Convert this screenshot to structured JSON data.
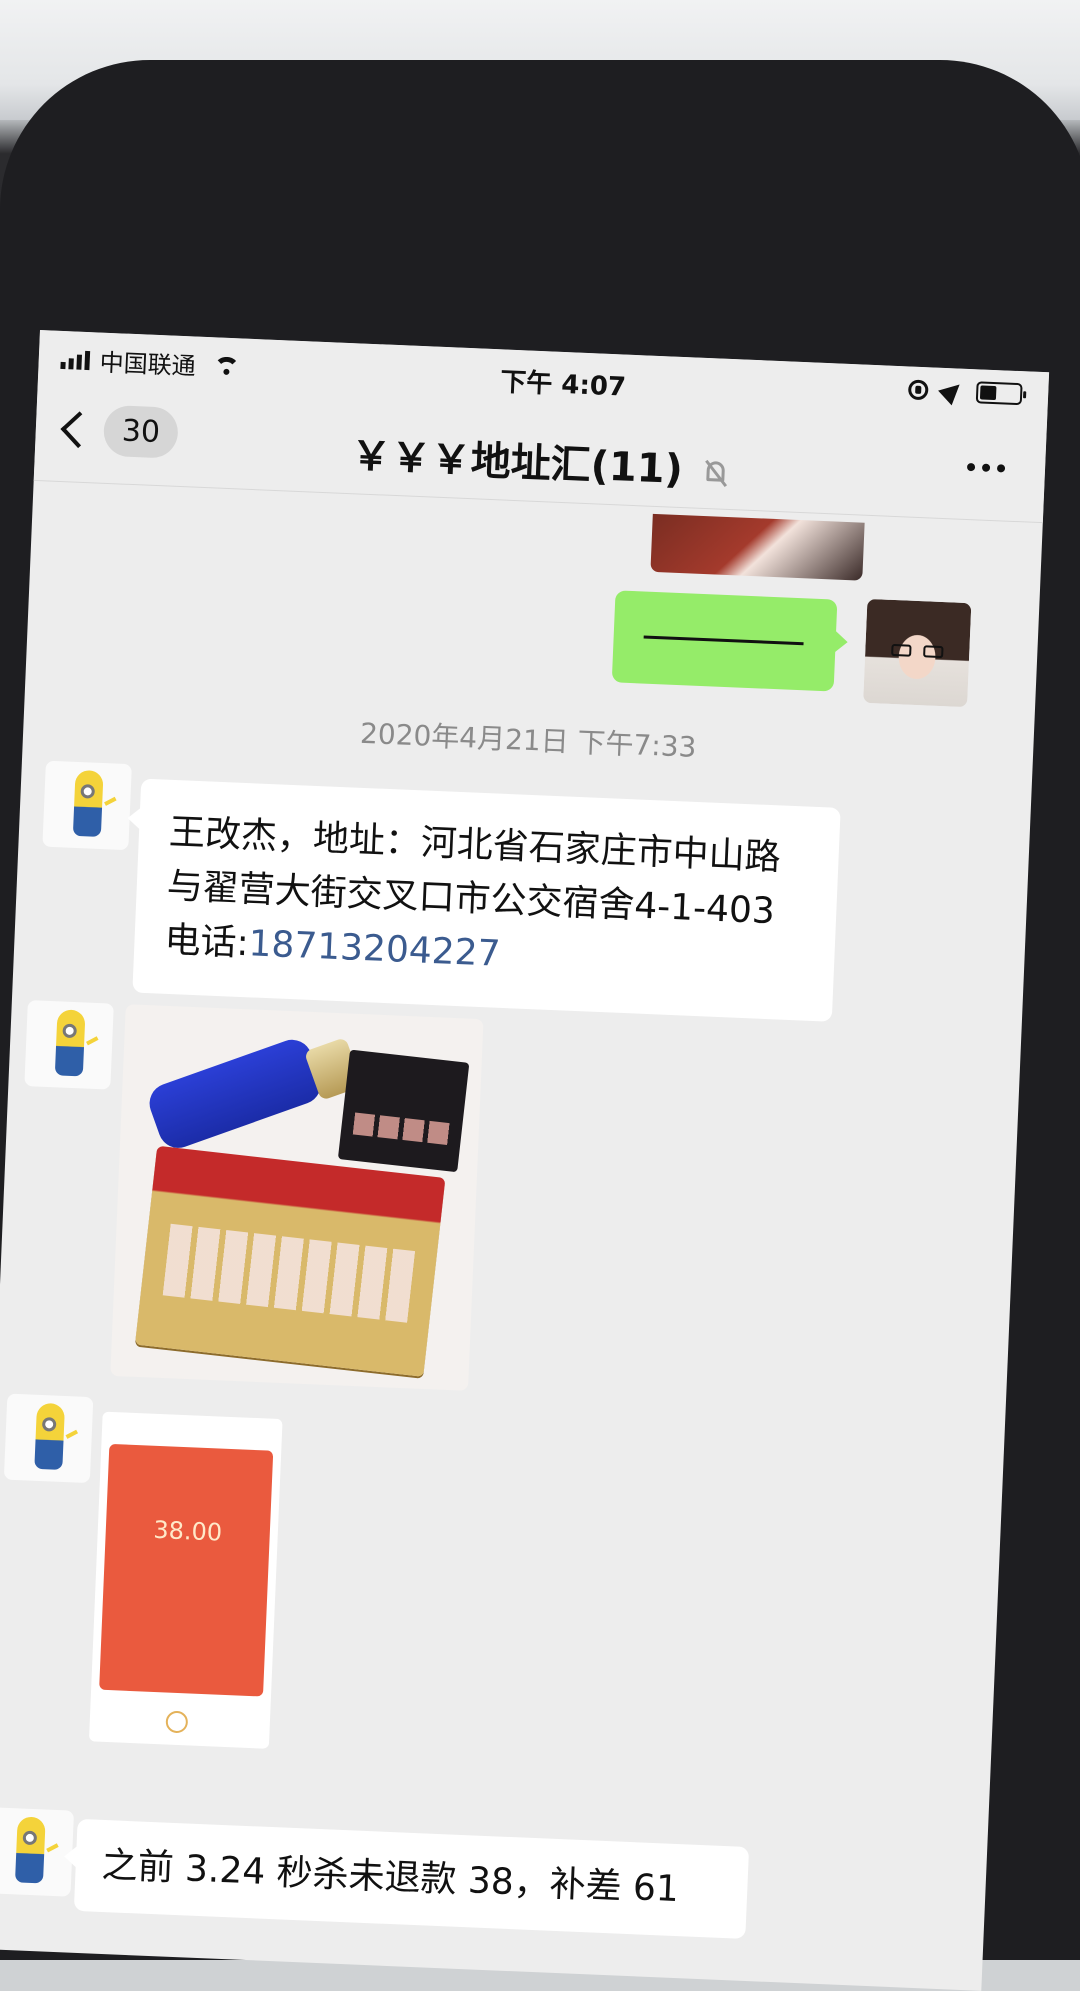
{
  "status_bar": {
    "carrier": "中国联通",
    "time": "下午 4:07"
  },
  "nav": {
    "back_count": "30",
    "title": "￥￥￥地址汇(11)",
    "title_muted": true
  },
  "messages": {
    "timestamp": "2020年4月21日 下午7:33",
    "address_message": {
      "text": "王改杰，地址：河北省石家庄市中山路与翟营大街交叉口市公交宿舍4-1-403 电话:",
      "phone": "18713204227"
    },
    "red_packet": {
      "amount": "38.00"
    },
    "last_message_preview": "之前 3.24 秒杀未退款 38，补差 61"
  },
  "colors": {
    "self_bubble": "#95ec69",
    "other_bubble": "#ffffff",
    "chat_background": "#ededed",
    "link": "#3b5b8f",
    "red_packet": "#ea5a3e"
  },
  "icons": {
    "signal": "signal-icon",
    "wifi": "wifi-icon",
    "orientation_lock": "orientation-lock-icon",
    "location": "location-icon",
    "battery": "battery-icon",
    "back": "chevron-left-icon",
    "mute": "mute-bell-icon",
    "more": "more-dots-icon"
  }
}
